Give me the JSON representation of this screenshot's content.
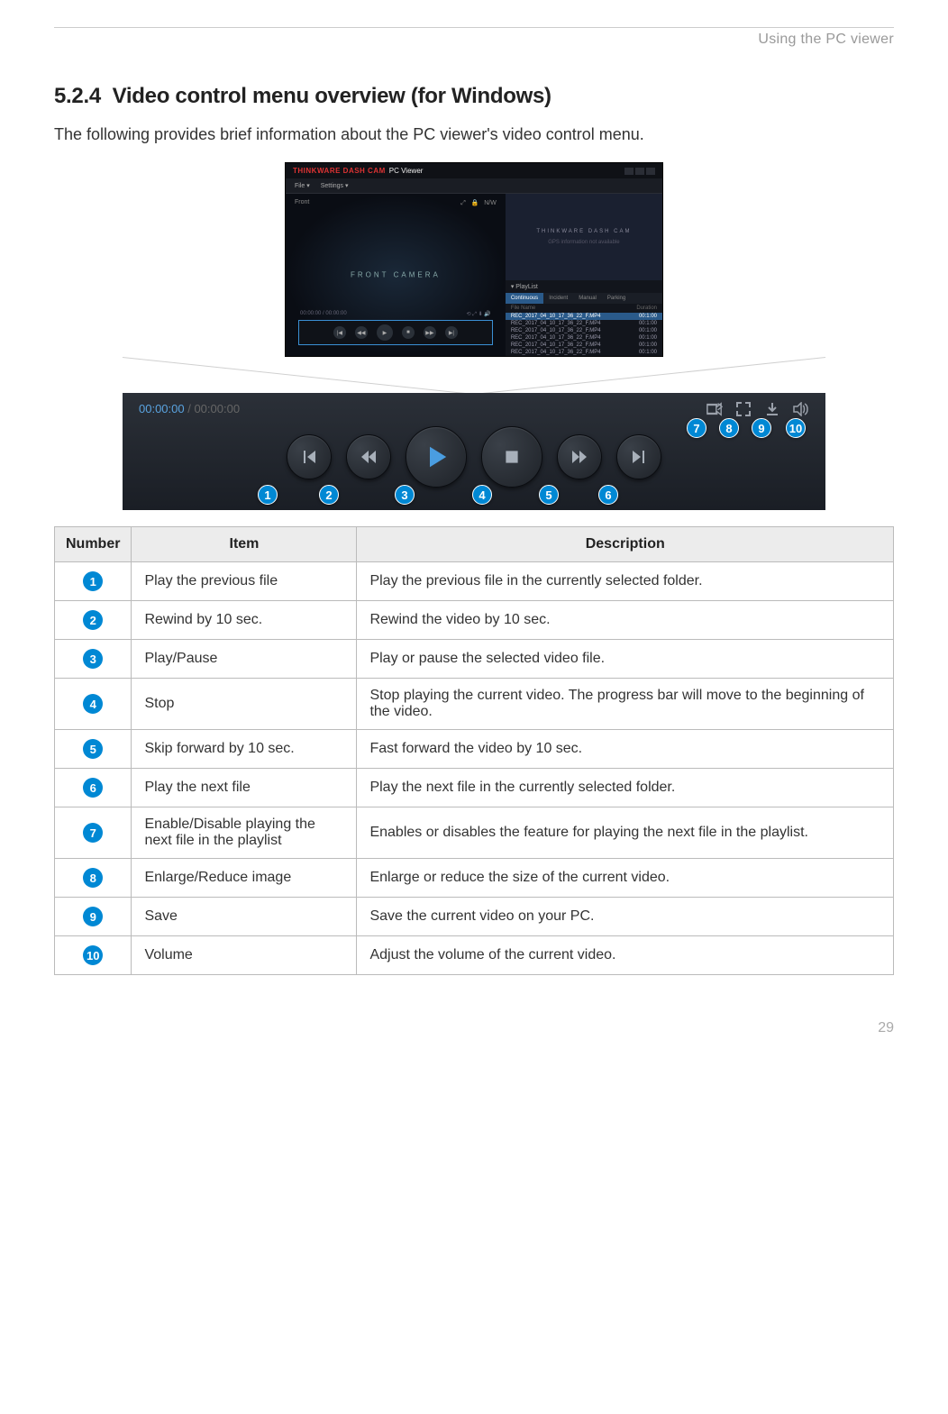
{
  "header": {
    "breadcrumb": "Using the PC viewer"
  },
  "section": {
    "number": "5.2.4",
    "title": "Video control menu overview (for Windows)",
    "intro": "The following provides brief information about the PC viewer's video control menu."
  },
  "app": {
    "brand_red": "THINKWARE DASH CAM",
    "brand_suffix": "PC Viewer",
    "menu": [
      "File ▾",
      "Settings ▾"
    ],
    "front_tab": "Front",
    "front_label": "FRONT CAMERA",
    "map_brand": "THINKWARE DASH CAM",
    "playlist_label": "PlayList",
    "playlist_tabs": [
      "Continuous",
      "Incident",
      "Manual",
      "Parking"
    ],
    "playlist_head": [
      "File Name",
      "Duration"
    ],
    "playlist_rows": [
      {
        "name": "REC_2017_04_10_17_36_22_F.MP4",
        "dur": "00:1:00"
      },
      {
        "name": "REC_2017_04_10_17_36_22_F.MP4",
        "dur": "00:1:00"
      },
      {
        "name": "REC_2017_04_10_17_36_22_F.MP4",
        "dur": "00:1:00"
      },
      {
        "name": "REC_2017_04_10_17_36_22_F.MP4",
        "dur": "00:1:00"
      },
      {
        "name": "REC_2017_04_10_17_36_22_F.MP4",
        "dur": "00:1:00"
      },
      {
        "name": "REC_2017_04_10_17_36_22_F.MP4",
        "dur": "00:1:00"
      }
    ],
    "timecode_current": "00:00:00",
    "timecode_duration": "00:00:00"
  },
  "table": {
    "headers": [
      "Number",
      "Item",
      "Description"
    ],
    "rows": [
      {
        "n": "1",
        "item": "Play the previous file",
        "desc": "Play the previous file in the currently selected folder."
      },
      {
        "n": "2",
        "item": "Rewind by 10 sec.",
        "desc": "Rewind the video by 10 sec."
      },
      {
        "n": "3",
        "item": "Play/Pause",
        "desc": "Play or pause the selected video file."
      },
      {
        "n": "4",
        "item": "Stop",
        "desc": "Stop playing the current video. The progress bar will move to the beginning of the video."
      },
      {
        "n": "5",
        "item": "Skip forward by 10 sec.",
        "desc": "Fast forward the video by 10 sec."
      },
      {
        "n": "6",
        "item": "Play the next file",
        "desc": "Play the next file in the currently selected folder."
      },
      {
        "n": "7",
        "item": "Enable/Disable playing the next file in the playlist",
        "desc": "Enables or disables the feature for playing the next file in the playlist."
      },
      {
        "n": "8",
        "item": "Enlarge/Reduce image",
        "desc": "Enlarge or reduce the size of the current video."
      },
      {
        "n": "9",
        "item": "Save",
        "desc": "Save the current video on your PC."
      },
      {
        "n": "10",
        "item": "Volume",
        "desc": "Adjust the volume of the current video."
      }
    ]
  },
  "page_number": "29"
}
